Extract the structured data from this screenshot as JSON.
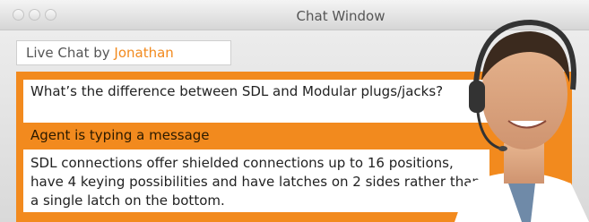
{
  "window": {
    "title": "Chat Window"
  },
  "tab": {
    "prefix": "Live Chat by ",
    "agent_name": "Jonathan"
  },
  "messages": [
    {
      "text": "What’s the difference between SDL and Modular plugs/jacks?"
    },
    {
      "text": "SDL connections offer shielded connections up to 16 positions, have 4 keying possibilities and have latches on 2 sides rather than a single latch on the bottom."
    }
  ],
  "status": {
    "typing": "Agent is typing a message"
  },
  "colors": {
    "accent": "#f28a1e"
  }
}
